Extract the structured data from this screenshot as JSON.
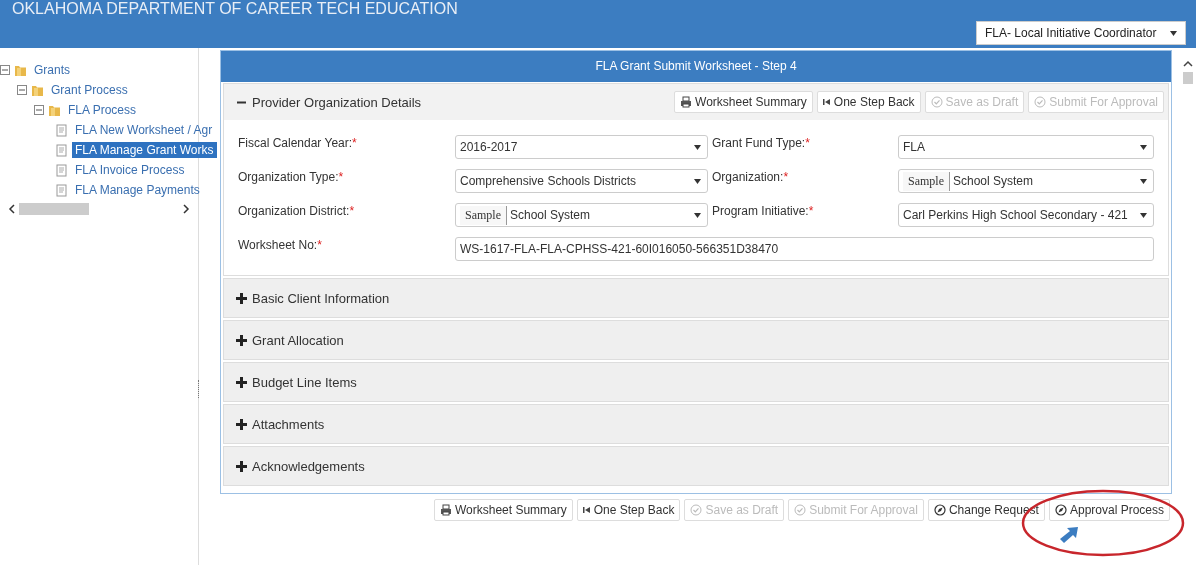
{
  "header": {
    "title": "OKLAHOMA DEPARTMENT OF CAREER TECH EDUCATION",
    "role_select": {
      "value": "FLA- Local Initiative Coordinator"
    }
  },
  "sidebar": {
    "tree": [
      {
        "label": "Grants",
        "kind": "folder",
        "expanded": true,
        "selected": false,
        "children": [
          {
            "label": "Grant Process",
            "kind": "folder",
            "expanded": true,
            "selected": false,
            "children": [
              {
                "label": "FLA Process",
                "kind": "folder",
                "expanded": true,
                "selected": false,
                "children": [
                  {
                    "label": "FLA New Worksheet / Agr",
                    "kind": "page",
                    "selected": false
                  },
                  {
                    "label": "FLA Manage Grant Works",
                    "kind": "page",
                    "selected": true
                  },
                  {
                    "label": "FLA Invoice Process",
                    "kind": "page",
                    "selected": false
                  },
                  {
                    "label": "FLA Manage Payments",
                    "kind": "page",
                    "selected": false
                  }
                ]
              }
            ]
          }
        ]
      }
    ]
  },
  "panel": {
    "title": "FLA Grant Submit Worksheet - Step 4",
    "sections": [
      {
        "title": "Provider Organization Details",
        "expanded": true,
        "toolbar": [
          {
            "label": "Worksheet Summary",
            "kind": "print",
            "disabled": false
          },
          {
            "label": "One Step Back",
            "kind": "back",
            "disabled": false
          },
          {
            "label": "Save as Draft",
            "kind": "check",
            "disabled": true
          },
          {
            "label": "Submit For Approval",
            "kind": "check",
            "disabled": true
          }
        ],
        "fields": [
          {
            "label": "Fiscal Calendar Year:",
            "required_mark": "*",
            "kind": "select",
            "value": "2016-2017"
          },
          {
            "label": "Grant Fund Type:",
            "required_mark": "*",
            "kind": "select",
            "value": "FLA"
          },
          {
            "label": "Organization Type:",
            "required_mark": "*",
            "kind": "select",
            "value": "Comprehensive Schools Districts"
          },
          {
            "label": "Organization:",
            "required_mark": "*",
            "kind": "select",
            "tag": "Sample",
            "value": "School System"
          },
          {
            "label": "Organization District:",
            "required_mark": "*",
            "kind": "select",
            "tag": "Sample",
            "value": "School System"
          },
          {
            "label": "Program Initiative:",
            "required_mark": "*",
            "kind": "select",
            "value": "Carl Perkins High School Secondary - 421"
          },
          {
            "label": "Worksheet No:",
            "required_mark": "*",
            "kind": "text",
            "value": "WS-1617-FLA-FLA-CPHSS-421-60I016050-566351D38470"
          }
        ]
      },
      {
        "title": "Basic Client Information",
        "expanded": false
      },
      {
        "title": "Grant Allocation",
        "expanded": false
      },
      {
        "title": "Budget Line Items",
        "expanded": false
      },
      {
        "title": "Attachments",
        "expanded": false
      },
      {
        "title": "Acknowledgements",
        "expanded": false
      }
    ]
  },
  "footer_buttons": [
    {
      "label": "Worksheet Summary",
      "kind": "print",
      "disabled": false,
      "highlighted": false
    },
    {
      "label": "One Step Back",
      "kind": "back",
      "disabled": false,
      "highlighted": false
    },
    {
      "label": "Save as Draft",
      "kind": "check",
      "disabled": true,
      "highlighted": false
    },
    {
      "label": "Submit For Approval",
      "kind": "check",
      "disabled": true,
      "highlighted": false
    },
    {
      "label": "Change Request",
      "kind": "compass",
      "disabled": false,
      "highlighted": false
    },
    {
      "label": "Approval Process",
      "kind": "compass",
      "disabled": false,
      "highlighted": true
    }
  ]
}
